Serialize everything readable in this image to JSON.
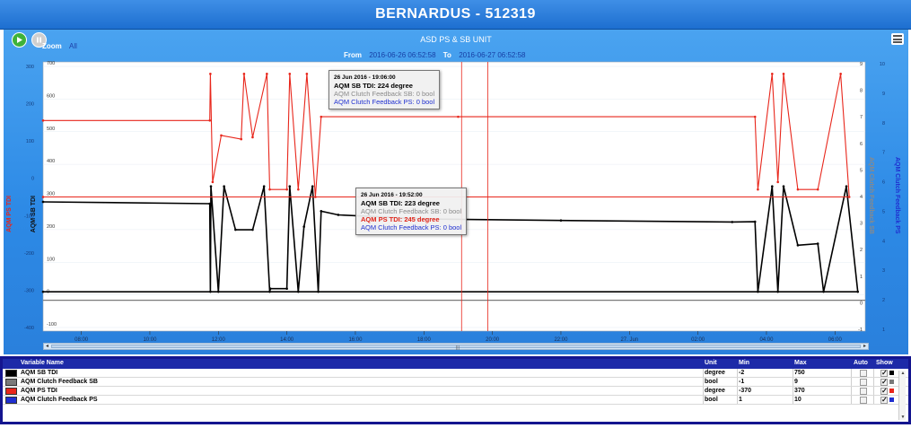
{
  "window": {
    "title": "BERNARDUS - 512319"
  },
  "toolbar": {
    "play_icon": "play-icon",
    "pause_icon": "pause-icon",
    "zoom_label": "Zoom",
    "zoom_all": "All",
    "chart_title": "ASD PS & SB UNIT",
    "from_label": "From",
    "from_value": "2016-06-26 06:52:58",
    "to_label": "To",
    "to_value": "2016-06-27 06:52:58",
    "menu_icon": "menu-icon"
  },
  "axes": {
    "left_outer_title": "AQM PS TDI",
    "left_inner_title": "AQM SB TDI",
    "right_inner_title": "AQM Clutch Feedback SB",
    "right_outer_title": "AQM Clutch Feedback PS",
    "left_outer_ticks": [
      "300",
      "200",
      "100",
      "0",
      "-100",
      "-200",
      "-300",
      "-400"
    ],
    "left_inner_ticks": [
      "700",
      "600",
      "500",
      "400",
      "300",
      "200",
      "100",
      "0",
      "-100"
    ],
    "right_inner_ticks": [
      "9",
      "8",
      "7",
      "6",
      "5",
      "4",
      "3",
      "2",
      "1",
      "0",
      "-1"
    ],
    "right_outer_ticks": [
      "10",
      "9",
      "8",
      "7",
      "6",
      "5",
      "4",
      "3",
      "2",
      "1"
    ],
    "x_ticks": [
      "08:00",
      "10:00",
      "12:00",
      "14:00",
      "16:00",
      "18:00",
      "20:00",
      "22:00",
      "27. Jun",
      "02:00",
      "04:00",
      "06:00"
    ]
  },
  "chart_data": {
    "type": "line",
    "x_unit": "time",
    "series": [
      {
        "name": "AQM SB TDI",
        "color": "#000000",
        "points": [
          [
            "06:53",
            300
          ],
          [
            "11:45",
            294
          ],
          [
            "11:46",
            10
          ],
          [
            "11:47",
            350
          ],
          [
            "12:00",
            10
          ],
          [
            "12:10",
            350
          ],
          [
            "12:30",
            210
          ],
          [
            "13:00",
            210
          ],
          [
            "13:20",
            350
          ],
          [
            "13:30",
            10
          ],
          [
            "13:31",
            20
          ],
          [
            "14:00",
            20
          ],
          [
            "14:05",
            350
          ],
          [
            "14:20",
            10
          ],
          [
            "14:30",
            220
          ],
          [
            "14:45",
            350
          ],
          [
            "14:55",
            10
          ],
          [
            "15:00",
            270
          ],
          [
            "15:30",
            258
          ],
          [
            "18:00",
            245
          ],
          [
            "22:00",
            240
          ],
          [
            "03:00",
            235
          ],
          [
            "03:40",
            236
          ],
          [
            "03:45",
            10
          ],
          [
            "04:10",
            350
          ],
          [
            "04:20",
            10
          ],
          [
            "04:30",
            350
          ],
          [
            "04:55",
            160
          ],
          [
            "05:30",
            165
          ],
          [
            "05:40",
            10
          ],
          [
            "06:20",
            350
          ],
          [
            "06:40",
            10
          ],
          [
            "06:53",
            10
          ]
        ]
      },
      {
        "name": "AQM PS TDI",
        "color": "#e8261b",
        "points": [
          [
            "06:53",
            245
          ],
          [
            "11:45",
            245
          ],
          [
            "11:46",
            370
          ],
          [
            "11:50",
            80
          ],
          [
            "12:05",
            205
          ],
          [
            "12:40",
            195
          ],
          [
            "12:45",
            370
          ],
          [
            "13:00",
            200
          ],
          [
            "13:25",
            370
          ],
          [
            "13:30",
            60
          ],
          [
            "14:00",
            60
          ],
          [
            "14:05",
            370
          ],
          [
            "14:20",
            60
          ],
          [
            "14:35",
            370
          ],
          [
            "14:50",
            40
          ],
          [
            "15:00",
            255
          ],
          [
            "19:00",
            255
          ],
          [
            "03:40",
            255
          ],
          [
            "03:45",
            60
          ],
          [
            "04:10",
            370
          ],
          [
            "04:20",
            80
          ],
          [
            "04:30",
            370
          ],
          [
            "04:55",
            60
          ],
          [
            "05:30",
            60
          ],
          [
            "06:10",
            370
          ],
          [
            "06:25",
            40
          ],
          [
            "06:53",
            40
          ]
        ]
      },
      {
        "name": "AQM Clutch Feedback SB",
        "color": "#8a8a8a",
        "points": [
          [
            "06:53",
            0
          ],
          [
            "06:00",
            0
          ]
        ]
      },
      {
        "name": "AQM Clutch Feedback PS",
        "color": "#1f2fd0",
        "points": [
          [
            "06:53",
            0
          ],
          [
            "06:00",
            0
          ]
        ]
      }
    ],
    "crosshairs": [
      "19:06",
      "19:52"
    ],
    "tooltips": [
      {
        "date": "26 Jun 2016 - 19:06:00",
        "sb": "AQM SB TDI: 224 degree",
        "cf_sb": "AQM Clutch Feedback SB: 0 bool",
        "ps": "",
        "cf_ps": "AQM Clutch Feedback PS: 0 bool"
      },
      {
        "date": "26 Jun 2016 - 19:52:00",
        "sb": "AQM SB TDI: 223 degree",
        "cf_sb": "AQM Clutch Feedback SB: 0 bool",
        "ps": "AQM PS TDI: 245 degree",
        "cf_ps": "AQM Clutch Feedback PS: 0 bool"
      }
    ]
  },
  "grid": {
    "columns": {
      "name": "Variable Name",
      "unit": "Unit",
      "min": "Min",
      "max": "Max",
      "auto": "Auto",
      "show": "Show"
    },
    "rows": [
      {
        "name": "AQM SB TDI",
        "unit": "degree",
        "min": "-2",
        "max": "750",
        "color": "#000000",
        "auto": false,
        "show": true
      },
      {
        "name": "AQM Clutch Feedback SB",
        "unit": "bool",
        "min": "-1",
        "max": "9",
        "color": "#7a7a7a",
        "auto": false,
        "show": true
      },
      {
        "name": "AQM PS TDI",
        "unit": "degree",
        "min": "-370",
        "max": "370",
        "color": "#e8261b",
        "auto": false,
        "show": true
      },
      {
        "name": "AQM Clutch Feedback PS",
        "unit": "bool",
        "min": "1",
        "max": "10",
        "color": "#1f2fd0",
        "auto": false,
        "show": true
      }
    ]
  }
}
